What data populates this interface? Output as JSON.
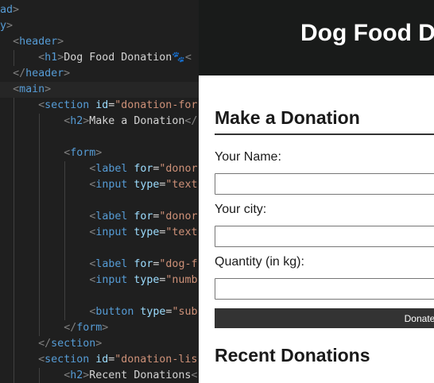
{
  "editor": {
    "lines": [
      [
        {
          "t": "head",
          "c": "tag"
        },
        {
          "t": ">",
          "c": "pun"
        }
      ],
      [
        {
          "t": "ody",
          "c": "tag"
        },
        {
          "t": ">",
          "c": "pun"
        }
      ],
      [
        {
          "t": "<",
          "c": "pun"
        },
        {
          "t": "header",
          "c": "tag"
        },
        {
          "t": ">",
          "c": "pun"
        }
      ],
      [
        {
          "t": "<",
          "c": "pun"
        },
        {
          "t": "h1",
          "c": "tag"
        },
        {
          "t": ">",
          "c": "pun"
        },
        {
          "t": "Dog Food Donation",
          "c": "txt"
        },
        {
          "t": "🐾",
          "c": "emo"
        },
        {
          "t": "<",
          "c": "pun"
        }
      ],
      [
        {
          "t": "</",
          "c": "pun"
        },
        {
          "t": "header",
          "c": "tag"
        },
        {
          "t": ">",
          "c": "pun"
        }
      ],
      [
        {
          "t": "<",
          "c": "pun"
        },
        {
          "t": "main",
          "c": "tag"
        },
        {
          "t": ">",
          "c": "pun"
        }
      ],
      [
        {
          "t": "<",
          "c": "pun"
        },
        {
          "t": "section",
          "c": "tag"
        },
        {
          "t": " ",
          "c": "txt"
        },
        {
          "t": "id",
          "c": "att"
        },
        {
          "t": "=",
          "c": "txt"
        },
        {
          "t": "\"donation-for",
          "c": "str"
        }
      ],
      [
        {
          "t": "<",
          "c": "pun"
        },
        {
          "t": "h2",
          "c": "tag"
        },
        {
          "t": ">",
          "c": "pun"
        },
        {
          "t": "Make a Donation",
          "c": "txt"
        },
        {
          "t": "</",
          "c": "pun"
        }
      ],
      [],
      [
        {
          "t": "<",
          "c": "pun"
        },
        {
          "t": "form",
          "c": "tag"
        },
        {
          "t": ">",
          "c": "pun"
        }
      ],
      [
        {
          "t": "<",
          "c": "pun"
        },
        {
          "t": "label",
          "c": "tag"
        },
        {
          "t": " ",
          "c": "txt"
        },
        {
          "t": "for",
          "c": "att"
        },
        {
          "t": "=",
          "c": "txt"
        },
        {
          "t": "\"donor",
          "c": "str"
        }
      ],
      [
        {
          "t": "<",
          "c": "pun"
        },
        {
          "t": "input",
          "c": "tag"
        },
        {
          "t": " ",
          "c": "txt"
        },
        {
          "t": "type",
          "c": "att"
        },
        {
          "t": "=",
          "c": "txt"
        },
        {
          "t": "\"text",
          "c": "str"
        }
      ],
      [],
      [
        {
          "t": "<",
          "c": "pun"
        },
        {
          "t": "label",
          "c": "tag"
        },
        {
          "t": " ",
          "c": "txt"
        },
        {
          "t": "for",
          "c": "att"
        },
        {
          "t": "=",
          "c": "txt"
        },
        {
          "t": "\"donor",
          "c": "str"
        }
      ],
      [
        {
          "t": "<",
          "c": "pun"
        },
        {
          "t": "input",
          "c": "tag"
        },
        {
          "t": " ",
          "c": "txt"
        },
        {
          "t": "type",
          "c": "att"
        },
        {
          "t": "=",
          "c": "txt"
        },
        {
          "t": "\"text",
          "c": "str"
        }
      ],
      [],
      [
        {
          "t": "<",
          "c": "pun"
        },
        {
          "t": "label",
          "c": "tag"
        },
        {
          "t": " ",
          "c": "txt"
        },
        {
          "t": "for",
          "c": "att"
        },
        {
          "t": "=",
          "c": "txt"
        },
        {
          "t": "\"dog-f",
          "c": "str"
        }
      ],
      [
        {
          "t": "<",
          "c": "pun"
        },
        {
          "t": "input",
          "c": "tag"
        },
        {
          "t": " ",
          "c": "txt"
        },
        {
          "t": "type",
          "c": "att"
        },
        {
          "t": "=",
          "c": "txt"
        },
        {
          "t": "\"numb",
          "c": "str"
        }
      ],
      [],
      [
        {
          "t": "<",
          "c": "pun"
        },
        {
          "t": "button",
          "c": "tag"
        },
        {
          "t": " ",
          "c": "txt"
        },
        {
          "t": "type",
          "c": "att"
        },
        {
          "t": "=",
          "c": "txt"
        },
        {
          "t": "\"sub",
          "c": "str"
        }
      ],
      [
        {
          "t": "</",
          "c": "pun"
        },
        {
          "t": "form",
          "c": "tag"
        },
        {
          "t": ">",
          "c": "pun"
        }
      ],
      [
        {
          "t": "</",
          "c": "pun"
        },
        {
          "t": "section",
          "c": "tag"
        },
        {
          "t": ">",
          "c": "pun"
        }
      ],
      [
        {
          "t": "<",
          "c": "pun"
        },
        {
          "t": "section",
          "c": "tag"
        },
        {
          "t": " ",
          "c": "txt"
        },
        {
          "t": "id",
          "c": "att"
        },
        {
          "t": "=",
          "c": "txt"
        },
        {
          "t": "\"donation-lis",
          "c": "str"
        }
      ],
      [
        {
          "t": "<",
          "c": "pun"
        },
        {
          "t": "h2",
          "c": "tag"
        },
        {
          "t": ">",
          "c": "pun"
        },
        {
          "t": "Recent Donations",
          "c": "txt"
        },
        {
          "t": "<",
          "c": "pun"
        }
      ]
    ]
  },
  "preview": {
    "site_title": "Dog Food Donation",
    "donation_form": {
      "title": "Make a Donation",
      "name_label": "Your Name:",
      "name_value": "",
      "city_label": "Your city:",
      "city_value": "",
      "quantity_label": "Quantity (in kg):",
      "quantity_value": "",
      "submit_label": "Donate"
    },
    "donation_list": {
      "title": "Recent Donations"
    }
  }
}
